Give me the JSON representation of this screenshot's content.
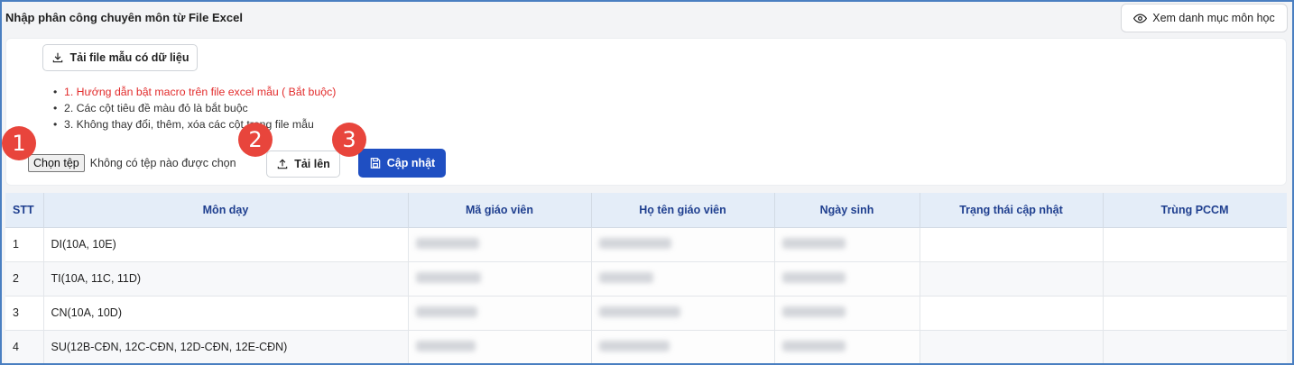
{
  "header": {
    "title": "Nhập phân công chuyên môn từ File Excel",
    "catalog_button": "Xem danh mục môn học",
    "catalog_icon": "eye-icon"
  },
  "toolbar": {
    "download_label": "Tải file mẫu có dữ liệu",
    "download_icon": "download-icon"
  },
  "guide": {
    "items": [
      "1. Hướng dẫn bật macro trên file excel mẫu ( Bắt buộc)",
      "2. Các cột tiêu đề màu đỏ là bắt buộc",
      "3. Không thay đổi, thêm, xóa các cột trong file mẫu"
    ]
  },
  "file": {
    "choose_label": "Chọn tệp",
    "no_file_text": "Không có tệp nào được chọn",
    "upload_label": "Tải lên",
    "upload_icon": "upload-icon",
    "update_label": "Cập nhật",
    "update_icon": "save-icon"
  },
  "steps": [
    "1",
    "2",
    "3"
  ],
  "colors": {
    "accent": "#1f4fc2",
    "step_badge": "#e8453c",
    "guide_required": "#e22b2b",
    "table_header_bg": "#e4edf8",
    "frame_border": "#4a7fc1"
  },
  "table": {
    "columns": [
      "STT",
      "Môn dạy",
      "Mã giáo viên",
      "Họ tên giáo viên",
      "Ngày sinh",
      "Trạng thái cập nhật",
      "Trùng PCCM"
    ],
    "rows": [
      {
        "stt": "1",
        "mon_day": "DI(10A, 10E)"
      },
      {
        "stt": "2",
        "mon_day": "TI(10A, 11C, 11D)"
      },
      {
        "stt": "3",
        "mon_day": "CN(10A, 10D)"
      },
      {
        "stt": "4",
        "mon_day": "SU(12B-CĐN, 12C-CĐN, 12D-CĐN, 12E-CĐN)"
      }
    ]
  }
}
